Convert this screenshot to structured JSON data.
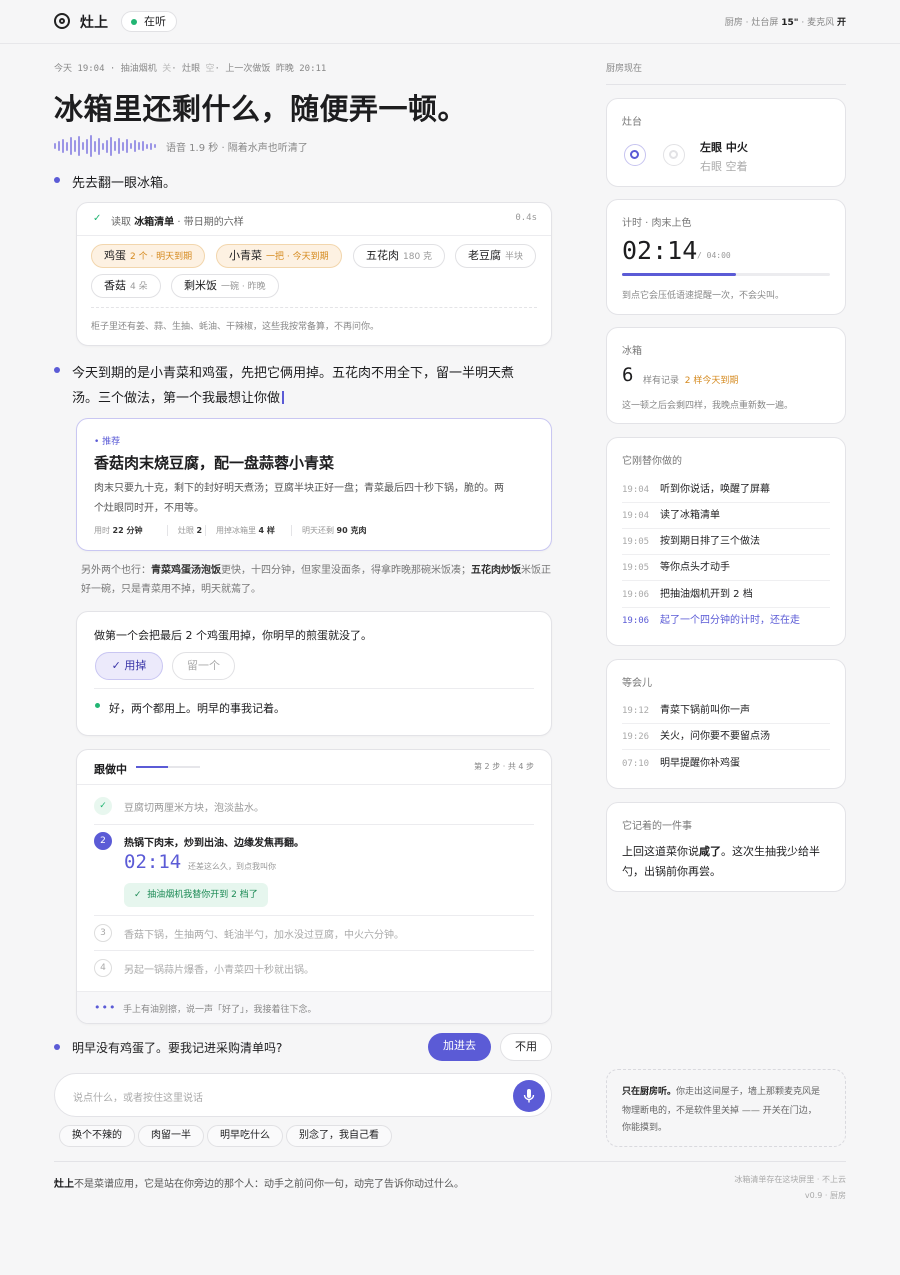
{
  "header": {
    "app_name": "灶上",
    "status": "在听",
    "stat_label": "厨房",
    "stat_screen_label": "灶台屏",
    "stat_screen_value": "15\"",
    "stat_mic_label": "麦克风",
    "stat_mic_value": "开"
  },
  "meta": {
    "time": "今天 19:04",
    "hood": "抽油烟机",
    "hood_state": "关",
    "stove": "灶眼",
    "stove_state": "空",
    "last_label": "上一次做饭",
    "last_value": "昨晚 20:11"
  },
  "title": "冰箱里还剩什么，随便弄一顿。",
  "voice": {
    "caption": "语音 1.9 秒 · 隔着水声也听清了"
  },
  "msg1": "先去翻一眼冰箱。",
  "fridge_card": {
    "prefix": "读取",
    "name": "冰箱清单",
    "desc": "带日期的六样",
    "duration": "0.4s",
    "items": [
      {
        "name": "鸡蛋",
        "sub": "2 个 · 明天到期"
      },
      {
        "name": "小青菜",
        "sub": "一把 · 今天到期"
      },
      {
        "name": "五花肉",
        "sub": "180 克"
      },
      {
        "name": "老豆腐",
        "sub": "半块"
      },
      {
        "name": "香菇",
        "sub": "4 朵"
      },
      {
        "name": "剩米饭",
        "sub": "一碗 · 昨晚"
      }
    ],
    "note": "柜子里还有姜、蒜、生抽、蚝油、干辣椒，这些我按常备算，不再问你。"
  },
  "msg2_line1": "今天到期的是小青菜和鸡蛋，先把它俩用掉。五花肉不用全下，留一半明天煮",
  "msg2_line2": "汤。三个做法，第一个我最想让你做",
  "recommend": {
    "tag": "推荐",
    "title": "香菇肉末烧豆腐，配一盘蒜蓉小青菜",
    "desc1": "肉末只要九十克，剩下的封好明天煮汤；豆腐半块正好一盘；青菜最后四十秒下锅，脆的。两",
    "desc2": "个灶眼同时开，不用等。",
    "stats": [
      {
        "label": "用时",
        "value": "22 分钟"
      },
      {
        "label": "灶眼",
        "value": "2"
      },
      {
        "label": "用掉冰箱里",
        "value": "4 样"
      },
      {
        "label": "明天还剩",
        "value": "90 克肉"
      }
    ]
  },
  "alt": {
    "prefix": "另外两个也行：",
    "dish1": "青菜鸡蛋汤泡饭",
    "text1": "更快，十四分钟，但家里没面条，得拿昨晚那碗米饭凑；",
    "dish2": "五花肉炒饭",
    "text2": "米饭正好一碗，只是青菜用不掉，明天就蔫了。"
  },
  "question": {
    "text": "做第一个会把最后 2 个鸡蛋用掉，你明早的煎蛋就没了。",
    "yes": "用掉",
    "no": "留一个",
    "answer": "好，两个都用上。明早的事我记着。"
  },
  "cooking": {
    "title": "跟做中",
    "progress_label": "第 2 步 · 共 4 步",
    "progress": 0.5,
    "steps": [
      {
        "n": "✓",
        "text": "豆腐切两厘米方块，泡淡盐水。"
      },
      {
        "n": "2",
        "text": "热锅下肉末，炒到出油、边缘发焦再翻。",
        "timer": "02:14",
        "timer_note": "还差这么久，到点我叫你",
        "action": "抽油烟机我替你开到 2 档了"
      },
      {
        "n": "3",
        "text": "香菇下锅，生抽两勺、蚝油半勺，加水没过豆腐，中火六分钟。"
      },
      {
        "n": "4",
        "text": "另起一锅蒜片爆香，小青菜四十秒就出锅。"
      }
    ],
    "footer": "手上有油别擦，说一声「好了」，我接着往下念。"
  },
  "msg3": {
    "text": "明早没有鸡蛋了。要我记进采购清单吗?",
    "add": "加进去",
    "no": "不用"
  },
  "input": {
    "placeholder": "说点什么，或者按住这里说话"
  },
  "suggestions": [
    "换个不辣的",
    "肉留一半",
    "明早吃什么",
    "别念了，我自己看"
  ],
  "footer": {
    "brand": "灶上",
    "text": "不是菜谱应用，它是站在你旁边的那个人：动手之前问你一句，动完了告诉你动过什么。",
    "right1": "冰箱清单存在这块屏里 · 不上云",
    "right2": "v0.9 · 厨房"
  },
  "side": {
    "title": "厨房现在",
    "stove": {
      "title": "灶台",
      "left": "左眼 中火",
      "right": "右眼 空着"
    },
    "timer": {
      "title": "计时 · 肉末上色",
      "value": "02:14",
      "total": "/ 04:00",
      "progress": 0.55,
      "note": "到点它会压低语速提醒一次，不会尖叫。"
    },
    "fridge": {
      "title": "冰箱",
      "count": "6",
      "count_label": "样有记录",
      "expiring": "2 样今天到期",
      "note": "这一顿之后会剩四样，我晚点重新数一遍。"
    },
    "done": {
      "title": "它刚替你做的",
      "items": [
        {
          "t": "19:04",
          "text": "听到你说话，唤醒了屏幕"
        },
        {
          "t": "19:04",
          "text": "读了冰箱清单"
        },
        {
          "t": "19:05",
          "text": "按到期日排了三个做法"
        },
        {
          "t": "19:05",
          "text": "等你点头才动手"
        },
        {
          "t": "19:06",
          "text": "把抽油烟机开到 2 档"
        },
        {
          "t": "19:06",
          "text": "起了一个四分钟的计时，还在走"
        }
      ]
    },
    "later": {
      "title": "等会儿",
      "items": [
        {
          "t": "19:12",
          "text": "青菜下锅前叫你一声"
        },
        {
          "t": "19:26",
          "text": "关火，问你要不要留点汤"
        },
        {
          "t": "07:10",
          "text": "明早提醒你补鸡蛋"
        }
      ]
    },
    "memory": {
      "title": "它记着的一件事",
      "line1_pre": "上回这道菜你说",
      "line1_bold": "咸了",
      "line1_post": "。这次生抽我少给半",
      "line2": "勺，出锅前你再尝。"
    },
    "privacy": {
      "bold": "只在厨房听。",
      "line1": "你走出这间屋子，墙上那颗麦克风是",
      "line2": "物理断电的，不是软件里关掉 —— 开关在门边，",
      "line3": "你能摸到。"
    }
  }
}
